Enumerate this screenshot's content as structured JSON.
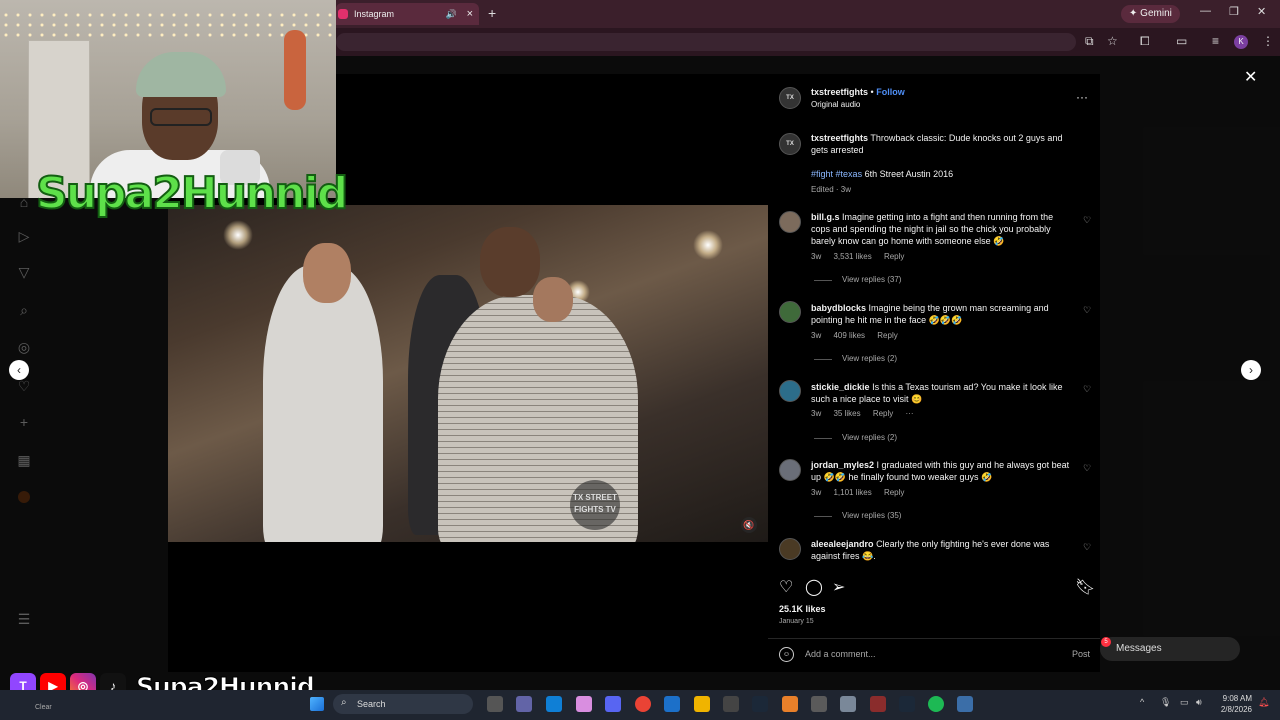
{
  "browser": {
    "tab_title": "Instagram",
    "new_tab": "+",
    "gemini_label": "Gemini",
    "profile_initial": "K"
  },
  "post": {
    "author": "txstreetfights",
    "separator": "•",
    "follow": "Follow",
    "audio": "Original audio",
    "caption_text": "Throwback classic: Dude knocks out 2 guys and gets arrested",
    "hashtag1": "#fight",
    "hashtag2": "#texas",
    "location_text": "6th Street Austin 2016",
    "edited": "Edited · 3w",
    "watermark": "TX STREET FIGHTS TV",
    "likes": "25.1K likes",
    "date": "January 15",
    "add_comment_placeholder": "Add a comment...",
    "post_button": "Post"
  },
  "comments": [
    {
      "user": "bill.g.s",
      "text": "Imagine getting into a fight and then running from the cops and spending the night in jail so the chick you probably barely know can go home with someone else 🤣",
      "age": "3w",
      "likes": "3,531 likes",
      "reply": "Reply",
      "replies": "View replies (37)"
    },
    {
      "user": "babydblocks",
      "text": "Imagine being the grown man screaming and pointing he hit me in the face 🤣🤣🤣",
      "age": "3w",
      "likes": "409 likes",
      "reply": "Reply",
      "replies": "View replies (2)"
    },
    {
      "user": "stickie_dickie",
      "text": "Is this a Texas tourism ad? You make it look like such a nice place to visit 😊",
      "age": "3w",
      "likes": "35 likes",
      "reply": "Reply",
      "more": "···",
      "replies": "View replies (2)"
    },
    {
      "user": "jordan_myles2",
      "text": "I graduated with this guy and he always got beat up 🤣🤣 he finally found two weaker guys 🤣",
      "age": "3w",
      "likes": "1,101 likes",
      "reply": "Reply",
      "replies": "View replies (35)"
    },
    {
      "user": "aleealeejandro",
      "text": "Clearly the only fighting he's ever done was against fires 😂.",
      "age": "",
      "likes": "",
      "reply": "",
      "replies": ""
    }
  ],
  "ui": {
    "messages": "Messages",
    "messages_badge": "5",
    "notif_badge": "9"
  },
  "stream": {
    "brand": "Supa2Hunnid",
    "social_handle": "Supa2Hunnid"
  },
  "taskbar": {
    "search": "Search",
    "time": "9:08 AM",
    "date": "2/8/2026",
    "clear": "Clear"
  },
  "colors": {
    "browser_tab_bar": "#3b1f2b",
    "follow_blue": "#4f8ff7",
    "brand_green": "#5ee04a"
  },
  "icons": [
    "heart-icon",
    "comment-icon",
    "share-icon",
    "bookmark-icon",
    "close-icon",
    "more-icon",
    "mute-icon",
    "search-icon",
    "emoji-icon",
    "chevron-left-icon",
    "chevron-right-icon"
  ]
}
